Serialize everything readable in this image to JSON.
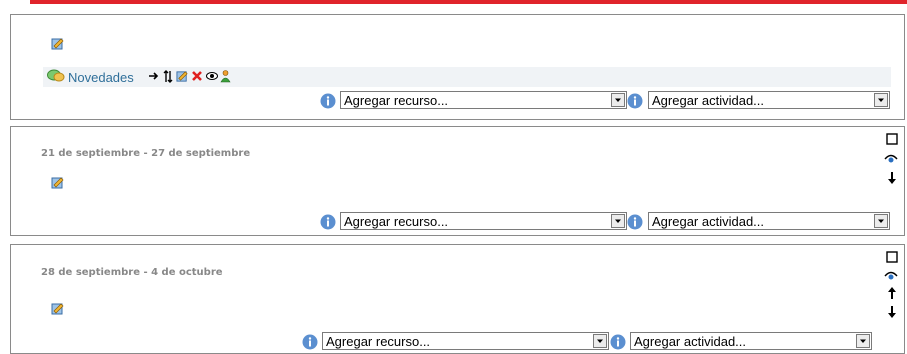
{
  "sections": [
    {
      "forum": {
        "label": "Novedades"
      },
      "add_resource": "Agregar recurso...",
      "add_activity": "Agregar actividad..."
    },
    {
      "date": "21 de septiembre - 27 de septiembre",
      "add_resource": "Agregar recurso...",
      "add_activity": "Agregar actividad..."
    },
    {
      "date": "28 de septiembre - 4 de octubre",
      "add_resource": "Agregar recurso...",
      "add_activity": "Agregar actividad..."
    }
  ],
  "colors": {
    "accent_bar": "#e0242b",
    "link": "#2f6f9a",
    "date_text": "#888888"
  }
}
